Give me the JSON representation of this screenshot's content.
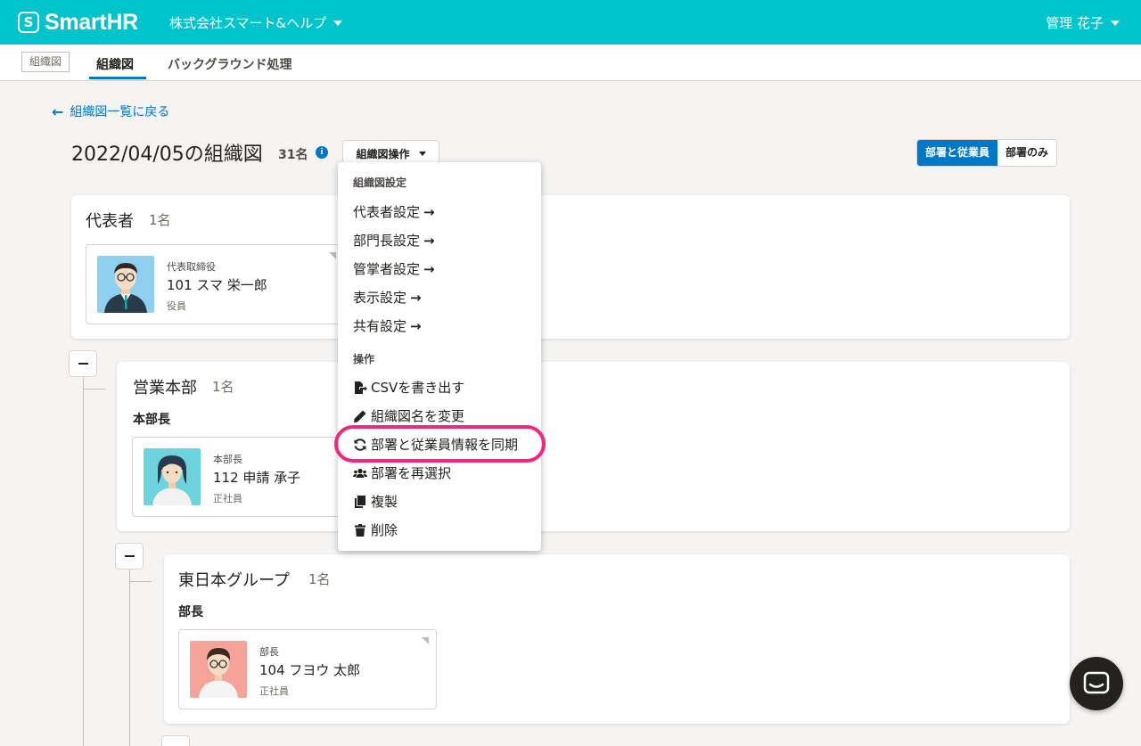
{
  "header": {
    "logo_mark": "S",
    "logo_text": "SmartHR",
    "company": "株式会社スマート&ヘルプ",
    "user": "管理 花子"
  },
  "subnav": {
    "badge": "組織図",
    "tabs": [
      {
        "label": "組織図",
        "active": true
      },
      {
        "label": "バックグラウンド処理",
        "active": false
      }
    ]
  },
  "back_link": "組織図一覧に戻る",
  "page": {
    "title": "2022/04/05の組織図",
    "member_count": "31名",
    "ops_button": "組織図操作",
    "view_toggle": [
      "部署と従業員",
      "部署のみ"
    ],
    "view_selected": "部署と従業員"
  },
  "menu": {
    "section_settings": "組織図設定",
    "settings_items": [
      "代表者設定",
      "部門長設定",
      "管掌者設定",
      "表示設定",
      "共有設定"
    ],
    "section_ops": "操作",
    "ops_items": [
      {
        "label": "CSVを書き出す",
        "icon": "file-export-icon"
      },
      {
        "label": "組織図名を変更",
        "icon": "pencil-icon"
      },
      {
        "label": "部署と従業員情報を同期",
        "icon": "sync-icon",
        "highlighted": true
      },
      {
        "label": "部署を再選択",
        "icon": "users-icon"
      },
      {
        "label": "複製",
        "icon": "copy-icon"
      },
      {
        "label": "削除",
        "icon": "trash-icon"
      }
    ]
  },
  "org": {
    "representative": {
      "name": "代表者",
      "count": "1名",
      "employee": {
        "title": "代表取締役",
        "name": "101 スマ 栄一郎",
        "type": "役員"
      }
    },
    "sales": {
      "name": "営業本部",
      "count": "1名",
      "role": "本部長",
      "employee": {
        "title": "本部長",
        "name": "112 申請 承子",
        "type": "正社員"
      }
    },
    "east": {
      "name": "東日本グループ",
      "count": "1名",
      "role": "部長",
      "employee": {
        "title": "部長",
        "name": "104 フヨウ 太郎",
        "type": "正社員"
      }
    }
  },
  "colors": {
    "brand": "#00c4cc",
    "link": "#0077c7",
    "highlight": "#f0297c"
  }
}
